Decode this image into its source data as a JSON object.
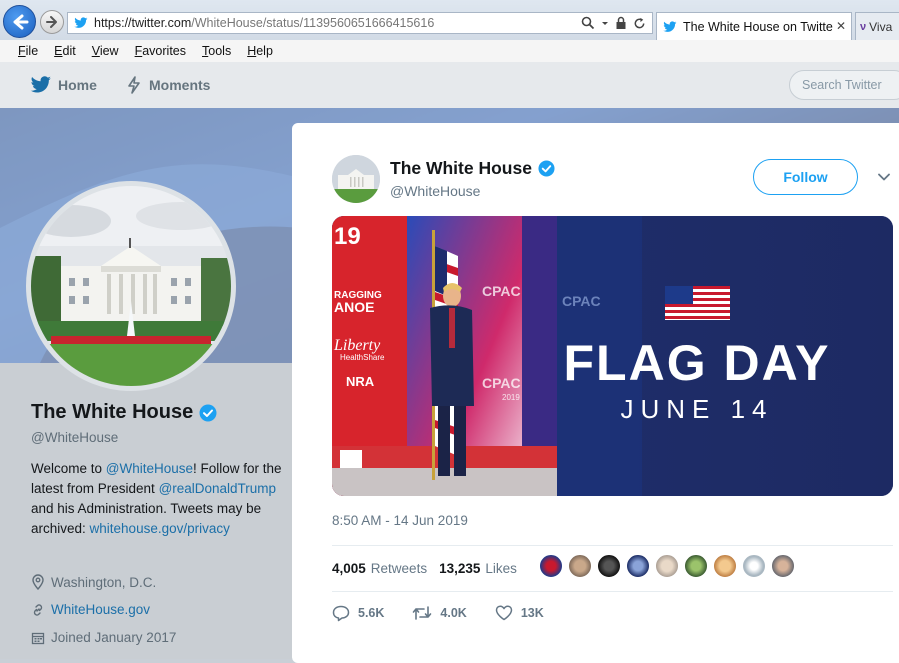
{
  "browser": {
    "url_prefix": "https://twitter.com",
    "url_path": "/WhiteHouse/status/1139560651666415616",
    "active_tab_title": "The White House on Twitte...",
    "tab2_title": "Viva",
    "menu": [
      "File",
      "Edit",
      "View",
      "Favorites",
      "Tools",
      "Help"
    ]
  },
  "twitter_nav": {
    "home": "Home",
    "moments": "Moments",
    "search_placeholder": "Search Twitter"
  },
  "profile": {
    "name": "The White House",
    "handle": "@WhiteHouse",
    "bio_1": "Welcome to ",
    "bio_link_1": "@WhiteHouse",
    "bio_2": "! Follow for the latest from President ",
    "bio_link_2": "@realDonaldTrump",
    "bio_3": " and his Administration. Tweets may be archived: ",
    "bio_link_3": "whitehouse.gov/privacy",
    "location": "Washington, D.C.",
    "website": "WhiteHouse.gov",
    "joined": "Joined January 2017"
  },
  "tweet": {
    "author_name": "The White House",
    "author_handle": "@WhiteHouse",
    "follow_label": "Follow",
    "media_headline": "FLAG DAY",
    "media_subhead": "JUNE 14",
    "banner_texts": [
      "19",
      "RAGGING",
      "ANOE",
      "Liberty",
      "HealthShare",
      "NRA",
      "CPAC",
      "2019"
    ],
    "timestamp": "8:50 AM - 14 Jun 2019",
    "retweets_count": "4,005",
    "retweets_label": "Retweets",
    "likes_count": "13,235",
    "likes_label": "Likes",
    "reply_count": "5.6K",
    "retweet_action_count": "4.0K",
    "like_action_count": "13K"
  },
  "colors": {
    "accent": "#1da1f2",
    "verified": "#1da1f2",
    "link": "#1b6fa8"
  }
}
